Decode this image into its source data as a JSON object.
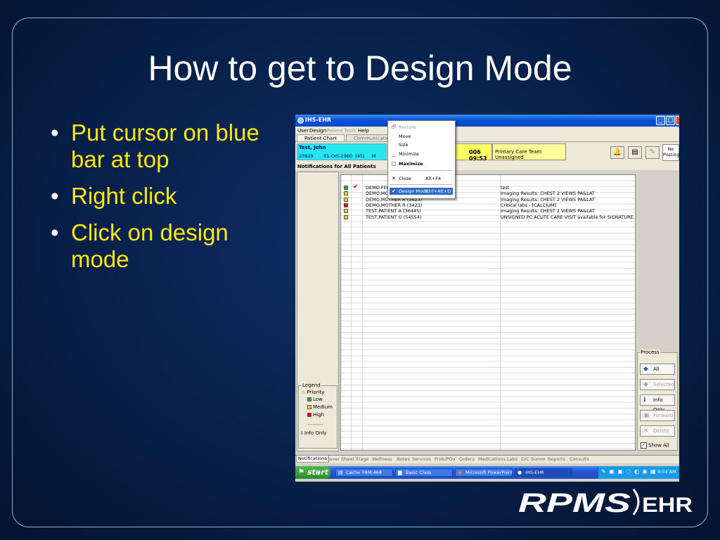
{
  "slide": {
    "title": "How to get to Design Mode",
    "bullets": [
      "Put cursor on blue bar at top",
      "Right click",
      "Click on design mode"
    ],
    "bullet_glyph": "•"
  },
  "window": {
    "title": "IHS-EHR",
    "menu": [
      "User",
      "Design",
      "Patient",
      "Tools",
      "Help"
    ],
    "tabs": [
      "Patient Chart",
      "Communication"
    ],
    "patient": {
      "name": "Test, John",
      "info": "23929       01-Oct-1960  (45)     M"
    },
    "visit_date": "006 09:53",
    "care_team": "Primary Care Team Unassigned",
    "postings": [
      "No",
      "Postings"
    ],
    "notifications_header": "Notifications for All Patients",
    "notifications": [
      {
        "priority": "low",
        "checked": true,
        "patient": "DEMO,FEM",
        "message": "test"
      },
      {
        "priority": "medium",
        "checked": false,
        "patient": "DEMO,MOT",
        "message": "Imaging Results: CHEST 2 VIEWS PA&LAT"
      },
      {
        "priority": "medium",
        "checked": false,
        "patient": "DEMO,MOTHER R   (3423)",
        "message": "Imaging Results: CHEST 2 VIEWS PA&LAT"
      },
      {
        "priority": "high",
        "checked": false,
        "patient": "DEMO,MOTHER R   (3423)",
        "message": "Critical labs - [CALCIUM]"
      },
      {
        "priority": "medium",
        "checked": false,
        "patient": "TEST,PATIENT A   (36445)",
        "message": "Imaging Results: CHEST 2 VIEWS PA&LAT"
      },
      {
        "priority": "medium",
        "checked": false,
        "patient": "TEST,PATIENT G   (54554)",
        "message": "UNSIGNED PC ACUTE CARE VISIT available for SIGNATURE."
      }
    ],
    "legend": {
      "title": "Legend",
      "priority": "Priority",
      "low": "Low",
      "medium": "Medium",
      "high": "High",
      "dashes": "---------",
      "info_only": "Info Only"
    },
    "process": {
      "title": "Process",
      "all": "All",
      "selected": "Selected",
      "info_only": "Info Only",
      "forward": "Forward",
      "delete": "Delete",
      "show_all": "Show All"
    },
    "bottom_tabs": [
      "Notifications",
      "Cover Sheet",
      "Triage",
      "Wellness",
      "Notes",
      "Services",
      "Prob/POV",
      "Orders",
      "Medications",
      "Labs",
      "D/C Summ",
      "Reports",
      "Consults"
    ]
  },
  "context_menu": {
    "items": [
      {
        "label": "Restore",
        "shortcut": "",
        "icon": "🗗",
        "state": "disabled"
      },
      {
        "label": "Move",
        "shortcut": "",
        "icon": "",
        "state": "normal"
      },
      {
        "label": "Size",
        "shortcut": "",
        "icon": "",
        "state": "normal"
      },
      {
        "label": "Minimize",
        "shortcut": "",
        "icon": "_",
        "state": "normal"
      },
      {
        "label": "Maximize",
        "shortcut": "",
        "icon": "□",
        "state": "bold"
      },
      {
        "label": "Close",
        "shortcut": "Alt+F4",
        "icon": "✕",
        "state": "normal"
      },
      {
        "label": "Design Mode",
        "shortcut": "Ctrl+Alt+D",
        "icon": "✔",
        "state": "selected"
      }
    ]
  },
  "taskbar": {
    "start": "start",
    "tasks": [
      "Cache TRM:468",
      "Basic Class",
      "Microsoft PowerPoint ...",
      "IHS-EHR"
    ],
    "clock": "9:54 AM"
  },
  "logo": {
    "rpms": "RPMS",
    "ehr": "EHR"
  },
  "colors": {
    "slide_bg": "#0a2654",
    "title_text": "#ffffff",
    "bullet_text": "#ffea00",
    "xp_title_blue": "#0a52d6",
    "patient_cyan": "#27e6ec",
    "menu_highlight": "#316ac5",
    "priority_low": "#21b021",
    "priority_medium": "#e8d21c",
    "priority_high": "#cc1111"
  }
}
